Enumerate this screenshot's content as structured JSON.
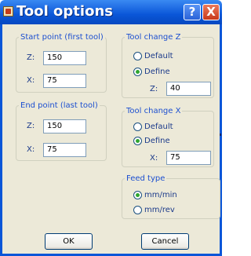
{
  "window": {
    "title": "Tool options",
    "help_label": "?",
    "close_label": "X"
  },
  "start_point": {
    "legend": "Start point (first tool)",
    "z_label": "Z:",
    "z_value": "150",
    "x_label": "X:",
    "x_value": "75"
  },
  "end_point": {
    "legend": "End point (last tool)",
    "z_label": "Z:",
    "z_value": "150",
    "x_label": "X:",
    "x_value": "75"
  },
  "tool_change_z": {
    "legend": "Tool change Z",
    "option_default": "Default",
    "option_define": "Define",
    "selected": "Define",
    "field_label": "Z:",
    "field_value": "40"
  },
  "tool_change_x": {
    "legend": "Tool change X",
    "option_default": "Default",
    "option_define": "Define",
    "selected": "Define",
    "field_label": "X:",
    "field_value": "75"
  },
  "feed_type": {
    "legend": "Feed type",
    "option_mm_min": "mm/min",
    "option_mm_rev": "mm/rev",
    "selected": "mm/min"
  },
  "buttons": {
    "ok_label": "OK",
    "cancel_label": "Cancel"
  },
  "colors": {
    "title_bar": "#0a56d8",
    "client_bg": "#ece9d8",
    "legend_text": "#1c4fd0",
    "radio_selected": "#2fa52f"
  }
}
